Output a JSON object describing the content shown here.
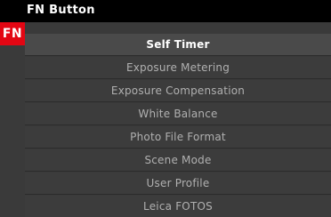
{
  "header": {
    "title": "FN Button",
    "badge": "FN",
    "badge_color": "#e30613"
  },
  "menu": {
    "items": [
      {
        "label": "Self Timer",
        "selected": true
      },
      {
        "label": "Exposure Metering",
        "selected": false
      },
      {
        "label": "Exposure Compensation",
        "selected": false
      },
      {
        "label": "White Balance",
        "selected": false
      },
      {
        "label": "Photo File Format",
        "selected": false
      },
      {
        "label": "Scene Mode",
        "selected": false
      },
      {
        "label": "User Profile",
        "selected": false
      },
      {
        "label": "Leica FOTOS",
        "selected": false
      }
    ]
  }
}
